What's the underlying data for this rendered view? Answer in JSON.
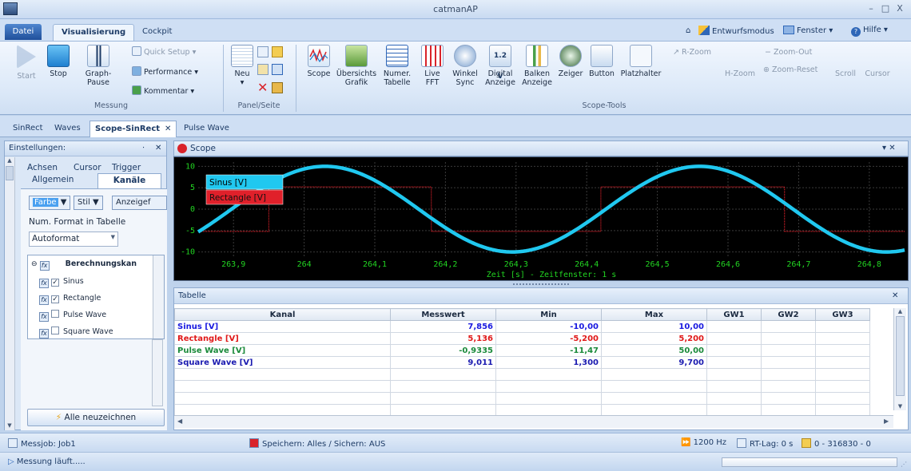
{
  "app": {
    "title": "catmanAP"
  },
  "ribbon_tabs": [
    {
      "label": "Datei"
    },
    {
      "label": "Visualisierung"
    },
    {
      "label": "Cockpit"
    }
  ],
  "top_right": {
    "design_mode": "Entwurfsmodus",
    "window": "Fenster",
    "help": "Hilfe"
  },
  "messung": {
    "start": "Start",
    "stop": "Stop",
    "graph_pause": "Graph-Pause",
    "quick_setup": "Quick Setup",
    "performance": "Performance",
    "kommentar": "Kommentar",
    "group": "Messung"
  },
  "panel": {
    "neu": "Neu",
    "group": "Panel/Seite"
  },
  "scope_tools": {
    "buttons": [
      {
        "label": "Scope"
      },
      {
        "label": "Übersichts\nGrafik"
      },
      {
        "label": "Numer.\nTabelle"
      },
      {
        "label": "Live\nFFT"
      },
      {
        "label": "Winkel\nSync"
      },
      {
        "label": "Digital\nAnzeige"
      },
      {
        "label": "Balken\nAnzeige"
      },
      {
        "label": "Zeiger"
      },
      {
        "label": "Button"
      },
      {
        "label": "Platzhalter"
      }
    ],
    "digital_icon_text": "1.2 V",
    "group": "Scope-Tools",
    "r_zoom": "R-Zoom",
    "h_zoom": "H-Zoom",
    "zoom_out": "Zoom-Out",
    "zoom_reset": "Zoom-Reset",
    "scroll": "Scroll",
    "cursor": "Cursor"
  },
  "doc_tabs": [
    {
      "label": "SinRect"
    },
    {
      "label": "Waves"
    },
    {
      "label": "Scope-SinRect"
    },
    {
      "label": "Pulse Wave"
    }
  ],
  "settings": {
    "title": "Einstellungen:",
    "tabs_row1": [
      "Achsen",
      "Cursor",
      "Trigger"
    ],
    "tabs_row2": [
      "Allgemein",
      "Kanäle"
    ],
    "farbe": "Farbe",
    "stil": "Stil",
    "anzeige": "Anzeigef",
    "num_format_label": "Num. Format in Tabelle",
    "num_format_value": "Autoformat",
    "list_header": "Berechnungskan",
    "channels": [
      {
        "name": "Sinus",
        "checked": true
      },
      {
        "name": "Rectangle",
        "checked": true
      },
      {
        "name": "Pulse Wave",
        "checked": false
      },
      {
        "name": "Square Wave",
        "checked": false
      }
    ],
    "redraw_button": "Alle neuzeichnen"
  },
  "scope": {
    "title": "Scope"
  },
  "chart_data": {
    "type": "line",
    "xlabel": "Zeit [s] - Zeitfenster: 1 s",
    "xlim": [
      263.85,
      264.85
    ],
    "ylim": [
      -11,
      11
    ],
    "xticks": [
      263.9,
      264.0,
      264.1,
      264.2,
      264.3,
      264.4,
      264.5,
      264.6,
      264.7,
      264.8
    ],
    "xtick_labels": [
      "263,9",
      "264",
      "264,1",
      "264,2",
      "264,3",
      "264,4",
      "264,5",
      "264,6",
      "264,7",
      "264,8"
    ],
    "yticks": [
      10,
      5,
      0,
      -5,
      -10
    ],
    "ytick_labels": [
      "10",
      "5",
      "0",
      "-5",
      "-10"
    ],
    "grid": true,
    "legend_position": "top-left",
    "series": [
      {
        "name": "Sinus [V]",
        "color": "#20c8f0",
        "kind": "sine",
        "amplitude": 10,
        "period": 0.53,
        "phase_x": 263.85,
        "phase_y": -5.3
      },
      {
        "name": "Rectangle [V]",
        "color": "#e0202a",
        "kind": "square",
        "high": 5.2,
        "low": -5.2,
        "edges": [
          263.95,
          264.18,
          264.42,
          264.68
        ]
      }
    ]
  },
  "table": {
    "title": "Tabelle",
    "columns": [
      "Kanal",
      "Messwert",
      "Min",
      "Max",
      "GW1",
      "GW2",
      "GW3"
    ],
    "rows": [
      {
        "kanal": "Sinus [V]",
        "messwert": "7,856",
        "min": "-10,00",
        "max": "10,00",
        "color": "#1a1ae0"
      },
      {
        "kanal": "Rectangle [V]",
        "messwert": "5,136",
        "min": "-5,200",
        "max": "5,200",
        "color": "#e01818"
      },
      {
        "kanal": "Pulse Wave [V]",
        "messwert": "-0,9335",
        "min": "-11,47",
        "max": "50,00",
        "color": "#1a8a3a"
      },
      {
        "kanal": "Square Wave [V]",
        "messwert": "9,011",
        "min": "1,300",
        "max": "9,700",
        "color": "#1a1ab0"
      }
    ]
  },
  "status": {
    "messjob": "Messjob: Job1",
    "speichern": "Speichern: Alles / Sichern: AUS",
    "rate": "1200 Hz",
    "rt_lag": "RT-Lag: 0 s",
    "range": "0 - 316830 - 0",
    "messung": "Messung läuft....."
  }
}
